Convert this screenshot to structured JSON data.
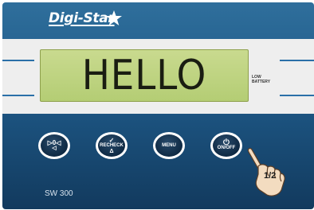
{
  "brand": {
    "name": "Digi-Star"
  },
  "display": {
    "text": "HELLO"
  },
  "indicator": {
    "low_battery_line1": "LOW",
    "low_battery_line2": "BATTERY"
  },
  "buttons": [
    {
      "id": "zero",
      "top_label": "▷0◁",
      "bottom_label": "◁"
    },
    {
      "id": "recheck",
      "top_label": "✓",
      "main_label": "RECHECK",
      "bottom_label": "Δ"
    },
    {
      "id": "menu",
      "main_label": "MENU"
    },
    {
      "id": "onoff",
      "top_label": "⏻",
      "main_label": "ON/OFF"
    }
  ],
  "model": "SW 300",
  "hand_label": "1/2",
  "colors": {
    "panel": "#1e5886",
    "lcd": "#b4cd74",
    "bezel": "#eeeeee",
    "accent_line": "#2a6fa8"
  }
}
